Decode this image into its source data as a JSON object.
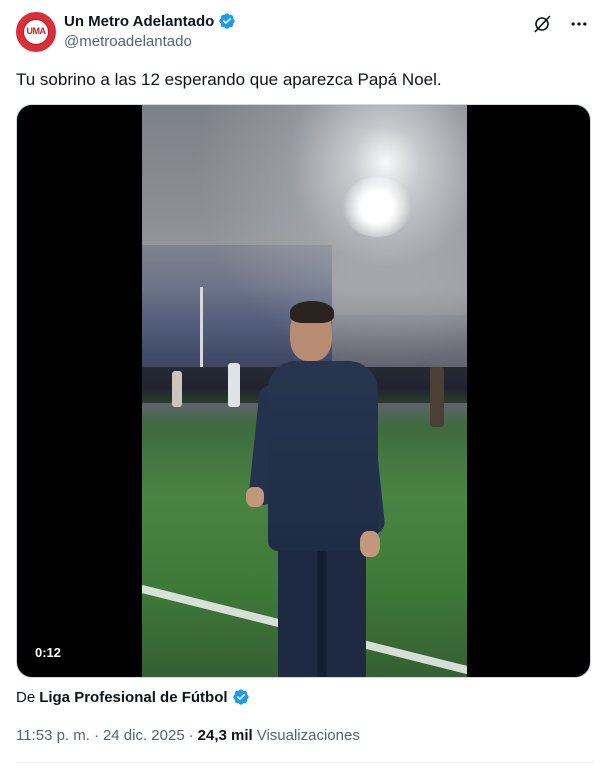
{
  "author": {
    "display_name": "Un Metro Adelantado",
    "handle": "@metroadelantado",
    "avatar_text": "UMA",
    "verified": true
  },
  "tweet": {
    "text": "Tu sobrino a las 12 esperando que aparezca Papá Noel."
  },
  "media": {
    "type": "video",
    "duration": "0:12"
  },
  "source": {
    "prefix": "De",
    "name": "Liga Profesional de Fútbol",
    "verified": true
  },
  "meta": {
    "time": "11:53 p. m.",
    "separator": "·",
    "date": "24 dic. 2025",
    "views_count": "24,3 mil",
    "views_label": "Visualizaciones"
  },
  "icons": {
    "verified": "verified-badge-icon",
    "grok": "grok-icon",
    "more": "more-options-icon"
  },
  "colors": {
    "verified": "#1d9bf0",
    "avatar": "#d92f38",
    "text_primary": "#0f1419",
    "text_secondary": "#536471"
  }
}
